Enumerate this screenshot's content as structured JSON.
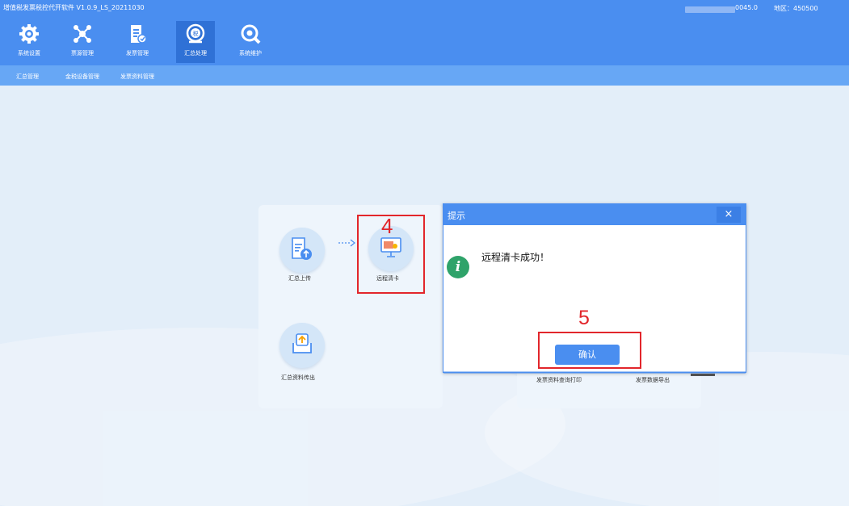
{
  "app": {
    "title": "增值税发票税控代开软件  V1.0.9_LS_20211030",
    "tax_id_suffix": "0045.0",
    "region": "地区：450500"
  },
  "toolbar": [
    {
      "label": "系统设置",
      "icon": "gear-icon"
    },
    {
      "label": "票源管理",
      "icon": "network-icon"
    },
    {
      "label": "发票管理",
      "icon": "invoice-icon"
    },
    {
      "label": "汇总处理",
      "icon": "tax-summary-icon",
      "active": true
    },
    {
      "label": "系统维护",
      "icon": "wrench-icon"
    }
  ],
  "submenu": [
    "汇总管理",
    "金税设备管理",
    "发票资料管理"
  ],
  "panel": {
    "summary_upload": "汇总上传",
    "remote_clear": "远程清卡",
    "summary_export": "汇总资料传出"
  },
  "behind": {
    "query_print": "发票资料查询打印",
    "data_export": "发票数据导出"
  },
  "annotations": {
    "step4": "4",
    "step5": "5",
    "highlight_color": "#e2262b"
  },
  "dialog": {
    "title": "提示",
    "close": "×",
    "message": "远程清卡成功！",
    "ok_label": "确认",
    "icon": "info-icon"
  },
  "colors": {
    "primary": "#4a8ef0",
    "active_tool": "#2f71d6",
    "background": "#e3eef9",
    "info_green": "#2fa36a"
  }
}
